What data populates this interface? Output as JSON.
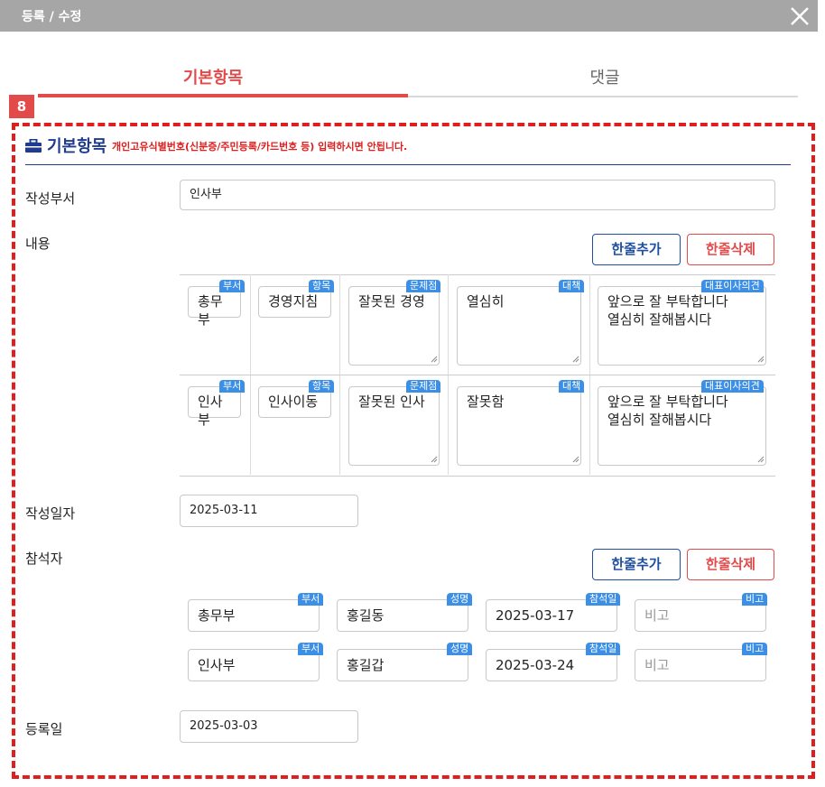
{
  "window": {
    "title": "등록 / 수정",
    "close_icon": "close-icon"
  },
  "tabs": [
    {
      "label": "기본항목",
      "active": true
    },
    {
      "label": "댓글",
      "active": false
    }
  ],
  "step_badge": "8",
  "section": {
    "title": "기본항목",
    "note": "개인고유식별번호(신분증/주민등록/카드번호 등) 입력하시면 안됩니다.",
    "icon": "briefcase-icon"
  },
  "form": {
    "dept_label": "작성부서",
    "dept_value": "인사부",
    "content_label": "내용",
    "date_label": "작성일자",
    "date_value": "2025-03-11",
    "attendees_label": "참석자",
    "reg_label": "등록일",
    "reg_value": "2025-03-03"
  },
  "buttons": {
    "add_row": "한줄추가",
    "delete_row": "한줄삭제"
  },
  "content_tags": {
    "dept": "부서",
    "item": "항목",
    "problem": "문제점",
    "measure": "대책",
    "ceo": "대표이사의견"
  },
  "content_rows": [
    {
      "dept": "총무부",
      "item": "경영지침",
      "problem": "잘못된 경영",
      "measure": "열심히",
      "ceo": "앞으로 잘 부탁합니다\n열심히 잘해봅시다"
    },
    {
      "dept": "인사부",
      "item": "인사이동",
      "problem": "잘못된 인사",
      "measure": "잘못함",
      "ceo": "앞으로 잘 부탁합니다\n열심히 잘해봅시다"
    }
  ],
  "attendee_tags": {
    "dept": "부서",
    "name": "성명",
    "date": "참석일",
    "note": "비고"
  },
  "attendee_rows": [
    {
      "dept": "총무부",
      "name": "홍길동",
      "date": "2025-03-17",
      "note_placeholder": "비고"
    },
    {
      "dept": "인사부",
      "name": "홍길갑",
      "date": "2025-03-24",
      "note_placeholder": "비고"
    }
  ],
  "colors": {
    "accent_red": "#e34a4a",
    "navy": "#1f3b8f",
    "tag_blue": "#3d8fe6",
    "titlebar": "#a6a6a6"
  }
}
